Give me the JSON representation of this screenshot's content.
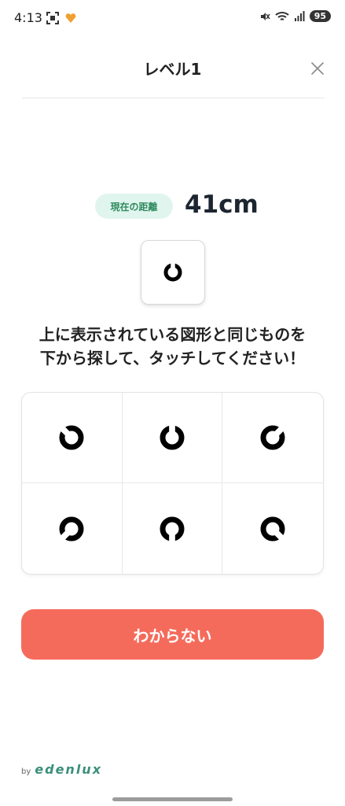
{
  "status_bar": {
    "time": "4:13",
    "battery": "95",
    "icons": [
      "screenshot-icon",
      "heart-app-icon",
      "mute-icon",
      "wifi-icon",
      "signal-icon"
    ]
  },
  "header": {
    "title": "レベル1",
    "close_icon": "close-icon"
  },
  "distance": {
    "label": "現在の距離",
    "value": "41cm"
  },
  "target": {
    "shape": "landolt-ring",
    "gap_direction": "up"
  },
  "instruction": {
    "line1": "上に表示されている図形と同じものを",
    "line2": "下から探して、タッチしてください！"
  },
  "choices": [
    {
      "shape": "landolt-ring",
      "gap_direction": "up-left"
    },
    {
      "shape": "landolt-ring",
      "gap_direction": "up"
    },
    {
      "shape": "landolt-ring",
      "gap_direction": "up-right"
    },
    {
      "shape": "landolt-ring",
      "gap_direction": "down-left"
    },
    {
      "shape": "landolt-ring",
      "gap_direction": "down"
    },
    {
      "shape": "landolt-ring",
      "gap_direction": "down-right"
    }
  ],
  "dont_know_button": {
    "label": "わからない"
  },
  "footer": {
    "by": "by",
    "brand": "edenlux"
  },
  "colors": {
    "accent_button": "#f56b5b",
    "distance_badge_bg": "#e0f5ee",
    "distance_badge_text": "#2f8a5f",
    "brand": "#3a8f7a"
  }
}
